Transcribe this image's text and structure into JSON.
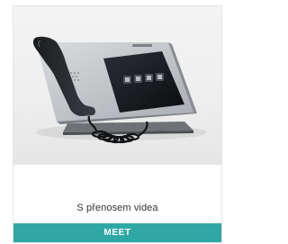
{
  "product_card": {
    "image_subject": "video-intercom-monitor",
    "caption": "S přenosem videa",
    "button_label": "MEET",
    "button_color": "#2fa8a5",
    "screen_color": "#111418"
  }
}
